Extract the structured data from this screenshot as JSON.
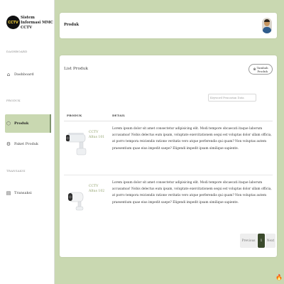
{
  "brand": {
    "logo_text": "CCTV",
    "title": "Sistem Informasi MMC CCTV"
  },
  "sidebar": {
    "sections": [
      {
        "label": "DASHBOARD",
        "items": [
          {
            "label": "Dashboard",
            "icon": "home-icon"
          }
        ]
      },
      {
        "label": "PRODUK",
        "items": [
          {
            "label": "Produk",
            "icon": "box-icon",
            "active": true
          },
          {
            "label": "Paket Produk",
            "icon": "gear-icon"
          }
        ]
      },
      {
        "label": "TRANSAKSI",
        "items": [
          {
            "label": "Transaksi",
            "icon": "document-icon"
          }
        ]
      }
    ]
  },
  "header": {
    "title": "Produk",
    "avatar_icon": "user-avatar"
  },
  "card": {
    "title": "List Produk",
    "add_button_label": "Tambah Produk",
    "search_placeholder": "Keyword Pencarian Data"
  },
  "table": {
    "headers": [
      "PRODUK",
      "DETAIL"
    ],
    "rows": [
      {
        "name": "CCTV Altus 101",
        "image": "cctv-bullet-camera-image",
        "detail": "Lorem ipsum dolor sit amet consectetur adipisicing elit. Modi tempore obcaecati itaque laborum accusamus! Nobis delectus eum ipsam, voluptate exercitationem sequi est voluptas dolor ullam officia, at porro tempora reiciendis ratione veritatis vero atque perferendis qui quam? Non voluptas autem praesentium quae eius impedit saepe? Eligendi impedit ipsam similique sapiente."
      },
      {
        "name": "CCTV Altus 102",
        "image": "cctv-compact-camera-image",
        "detail": "Lorem ipsum dolor sit amet consectetur adipisicing elit. Modi tempore obcaecati itaque laborum accusamus! Nobis delectus eum ipsam, voluptate exercitationem sequi est voluptas dolor ullam officia, at porro tempora reiciendis ratione veritatis vero atque perferendis qui quam? Non voluptas autem praesentium quae eius impedit saepe? Eligendi impedit ipsam similique sapiente."
      }
    ]
  },
  "pagination": {
    "prev_label": "Previous",
    "current_page": "1",
    "next_label": "Next"
  },
  "colors": {
    "accent": "#c9d8b1",
    "active_page": "#3b4a2c",
    "product_name": "#8fa06a"
  }
}
